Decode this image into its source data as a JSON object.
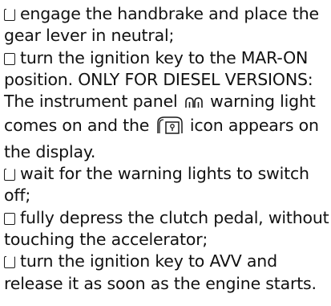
{
  "steps": [
    {
      "text": "engage the handbrake and place the gear lever in neutral;"
    },
    {
      "text_before": "turn the ignition key to the MAR-ON position. ONLY FOR DIESEL VERSIONS: The instrument panel",
      "text_middle": "warning light comes on and the",
      "text_after": "icon appears on the display."
    },
    {
      "text": "wait for the warning lights to switch off;"
    },
    {
      "text": "fully depress the clutch pedal, without touching the accelerator;"
    },
    {
      "text": "turn the ignition key to AVV and release it as soon as the engine starts."
    }
  ],
  "icons": {
    "checkbox": "checkbox-icon",
    "glow_plug": "glow-plug-warning-icon",
    "key_card": "key-card-icon"
  }
}
